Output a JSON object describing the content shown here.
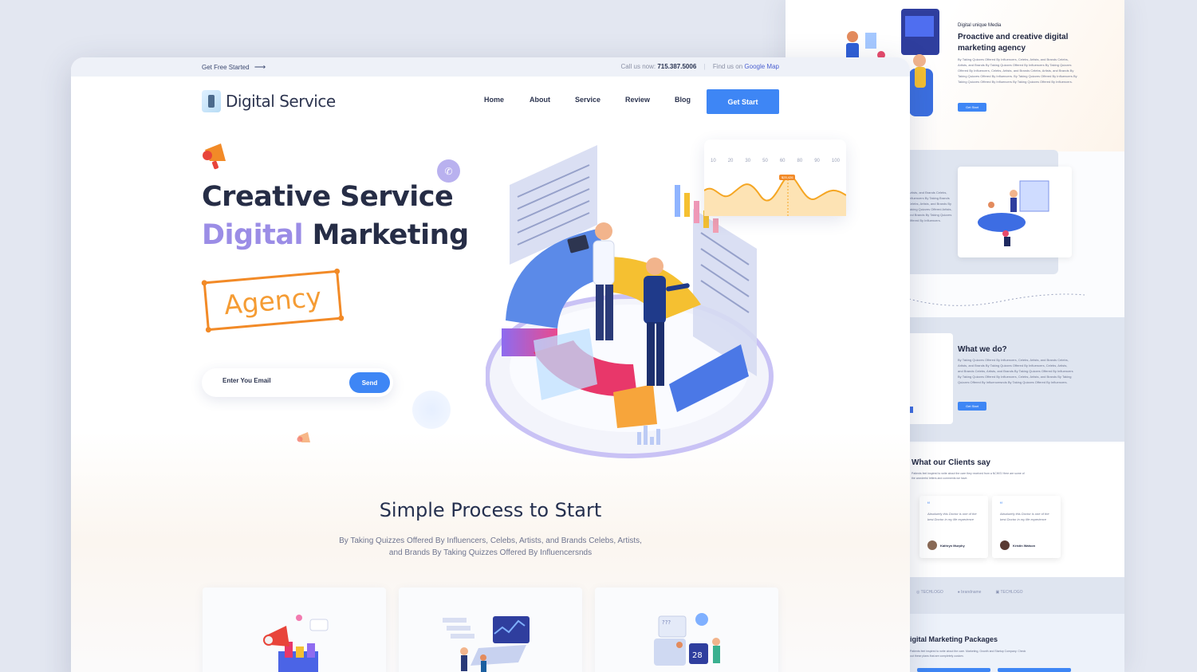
{
  "back_page": {
    "hero": {
      "kicker": "Digital unique Media",
      "title": "Proactive and creative digital marketing agency",
      "body": "By Taking Quizzes Offered By Influencers, Celebs, Artists, and Brands Celebs, Artists, and Brands By Taking Quizzes Offered By Influencers By Taking Quizzes Offered By Influencers, Celebs, Artists, and Brands Celebs, Artists, and Brands By Taking Quizzes Offered By Influencers. By Taking Quizzes Offered By Influencers By Taking Quizzes Offered By Influencers By Taking Quizzes Offered By Influencers.",
      "button": "Get Start"
    },
    "sec2_text": "Artists, and Brands Celebs, Influencers By Taking Brands Celebs, Artists, and Brands By Taking Quizzes Offered Artists, and Brands By Taking Quizzes Offered By Influencers.",
    "what": {
      "title": "What we do?",
      "body": "By Taking Quizzes Offered By Influencers, Celebs, Artists, and Brands Celebs, Artists, and Brands By Taking Quizzes Offered By Influencers, Celebs, Artists, and Brands Celebs, Artists, and Brands By Taking Quizzes Offered By Influencers By Taking Quizzes Offered By Influencers, Celebs, Artists, and Brands By Taking Quizzes Offered By Influencersnds By Taking Quizzes Offered By Influencers.",
      "button": "Get Start"
    },
    "testimonials": {
      "title": "What our Clients say",
      "intro": "Patients feel inspired to write about the care they received from a NCHIS! Here are some of the wonderful letters and comments we have.",
      "items": [
        {
          "quote": "Absolutely this Doctor is one of the best Doctor in my life experience",
          "name": "Kathryn Murphy"
        },
        {
          "quote": "Absolutely this Doctor is one of the best Doctor in my life experience",
          "name": "Kristin Watson"
        }
      ]
    },
    "logos": [
      "TECHLOGO",
      "brandname",
      "TECHLOGO"
    ],
    "packages": {
      "title": "igital Marketing Packages",
      "intro": "Patients feel inspired to write about the care. Marketing, Growth and Startup Company. Check out these plans that are completely custom."
    }
  },
  "topbar": {
    "left_link": "Get Free Started",
    "call_label": "Call us now:",
    "phone": "715.387.5006",
    "find_label": "Find us on",
    "map_link": "Google Map"
  },
  "header": {
    "brand": "Digital Service",
    "nav": [
      "Home",
      "About",
      "Service",
      "Review",
      "Blog"
    ],
    "cta": "Get Start"
  },
  "hero": {
    "line1": "Creative Service",
    "line2_accent": "Digital",
    "line2_rest": " Marketing",
    "badge": "Agency",
    "email_placeholder": "Enter You Email",
    "send": "Send",
    "chart_ticks": [
      "10",
      "20",
      "30",
      "50",
      "60",
      "80",
      "90",
      "100"
    ],
    "chart_tag": "$25,426"
  },
  "process": {
    "title": "Simple Process to Start",
    "description": "By Taking Quizzes Offered By Influencers, Celebs, Artists, and Brands Celebs, Artists, and Brands By Taking Quizzes Offered By Influencersnds"
  },
  "colors": {
    "accent": "#3e86f5",
    "purple": "#9b8de6",
    "orange": "#f28a27",
    "dark": "#262d46"
  }
}
